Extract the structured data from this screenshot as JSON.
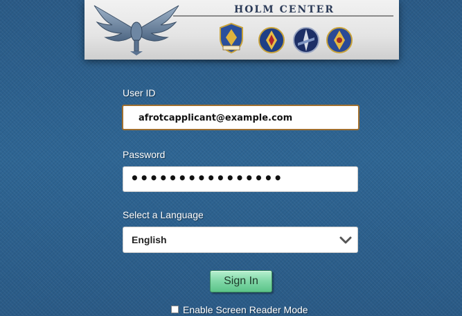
{
  "header": {
    "title": "HOLM CENTER",
    "logo_icon": "wings-emblem-icon",
    "shields": [
      "afrotc-shield-icon",
      "afjrotc-shield-icon",
      "ots-shield-icon",
      "holm-shield-icon"
    ]
  },
  "form": {
    "user_id": {
      "label": "User ID",
      "value": "afrotcapplicant@example.com"
    },
    "password": {
      "label": "Password",
      "masked_value": "••••••••••••••••"
    },
    "language": {
      "label": "Select a Language",
      "selected": "English",
      "icon": "chevron-down-icon"
    },
    "sign_in_label": "Sign In",
    "screen_reader": {
      "label": "Enable Screen Reader Mode",
      "checked": false
    }
  },
  "colors": {
    "background": "#2c5f8c",
    "focus_border": "#a06f2f",
    "button_green": "#7fd7a6"
  }
}
